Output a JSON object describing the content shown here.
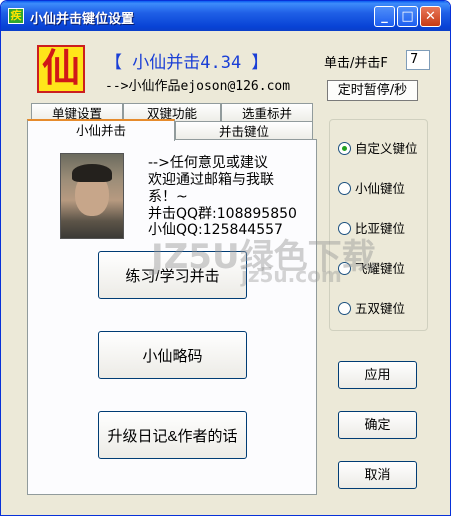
{
  "window": {
    "title": "小仙并击键位设置",
    "icon_char": "疾",
    "min_glyph": "_",
    "max_glyph": "□",
    "close_glyph": "✕"
  },
  "header": {
    "logo_char": "仙",
    "app_name": "【  小仙并击4.34  】",
    "author": "-->小仙作品ejoson@126.com"
  },
  "mode": {
    "label": "单击/并击F",
    "value": "7",
    "timer_button": "定时暂停/秒"
  },
  "tabs": {
    "row1": [
      "单键设置",
      "双键功能",
      "选重标并"
    ],
    "row2": [
      "小仙并击",
      "并击键位"
    ],
    "active": "小仙并击"
  },
  "contact": {
    "line1": "-->任何意见或建议",
    "line2": "欢迎通过邮箱与我联",
    "line3": "系！~",
    "line4": "并击QQ群:108895850",
    "line5": "小仙QQ:125844557"
  },
  "buttons": {
    "practice": "练习/学习并击",
    "shorthand": "小仙略码",
    "changelog": "升级日记&作者的话",
    "apply": "应用",
    "ok": "确定",
    "cancel": "取消"
  },
  "layout_options": {
    "items": [
      "自定义键位",
      "小仙键位",
      "比亚键位",
      "飞耀键位",
      "五双键位"
    ],
    "selected": "自定义键位"
  },
  "watermark": {
    "main": "JZ5U绿色下载",
    "sub": "jz5u.com"
  },
  "colors": {
    "titlebar": "#0843d6",
    "app_name": "#1a3fd6",
    "radio_dot": "#21a121"
  }
}
